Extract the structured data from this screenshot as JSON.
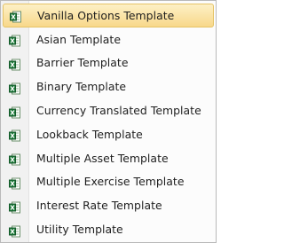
{
  "menu": {
    "items": [
      {
        "label": "Vanilla Options Template",
        "icon": "excel-icon",
        "selected": true
      },
      {
        "label": "Asian Template",
        "icon": "excel-icon",
        "selected": false
      },
      {
        "label": "Barrier Template",
        "icon": "excel-icon",
        "selected": false
      },
      {
        "label": "Binary Template",
        "icon": "excel-icon",
        "selected": false
      },
      {
        "label": "Currency Translated Template",
        "icon": "excel-icon",
        "selected": false
      },
      {
        "label": "Lookback Template",
        "icon": "excel-icon",
        "selected": false
      },
      {
        "label": "Multiple Asset Template",
        "icon": "excel-icon",
        "selected": false
      },
      {
        "label": "Multiple Exercise Template",
        "icon": "excel-icon",
        "selected": false
      },
      {
        "label": "Interest Rate Template",
        "icon": "excel-icon",
        "selected": false
      },
      {
        "label": "Utility Template",
        "icon": "excel-icon",
        "selected": false
      }
    ]
  },
  "colors": {
    "highlight_top": "#fdf0c6",
    "highlight_bottom": "#f8d88a",
    "highlight_border": "#e5c365",
    "excel_green": "#1d7a3a"
  }
}
